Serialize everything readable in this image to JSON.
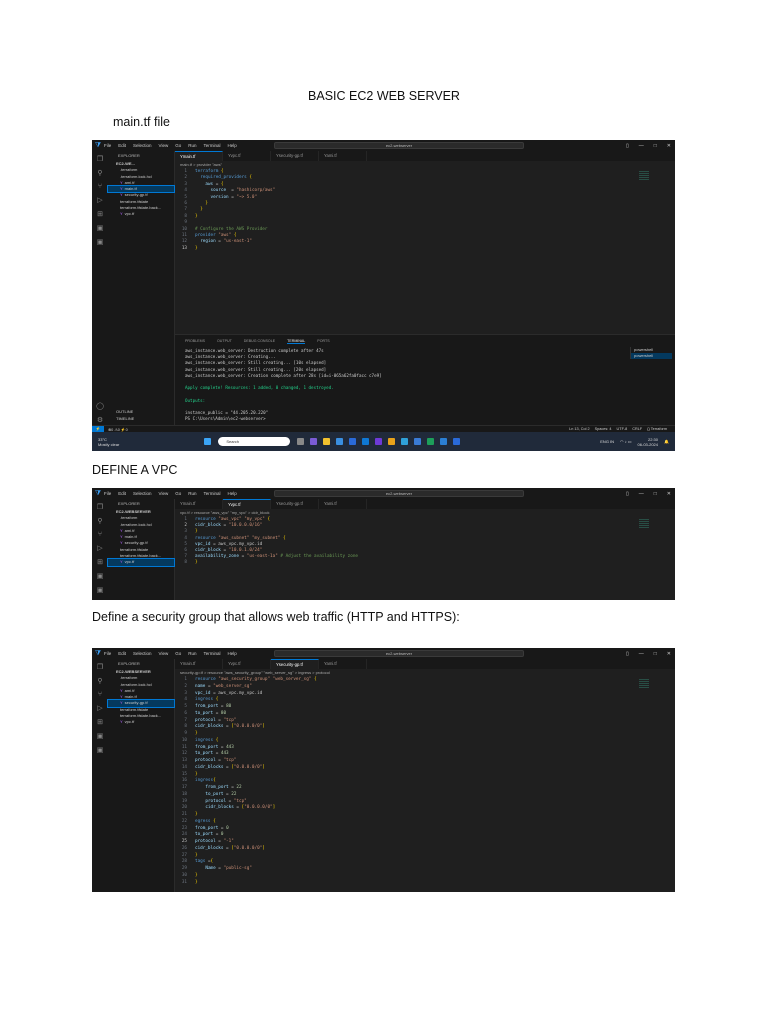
{
  "doc": {
    "title": "BASIC EC2 WEB SERVER",
    "section1": "main.tf file",
    "section2": "DEFINE A VPC",
    "section3": "Define a security group that allows web traffic (HTTP and HTTPS):"
  },
  "vscode": {
    "menu": [
      "File",
      "Edit",
      "Selection",
      "View",
      "Go",
      "Run",
      "Terminal",
      "Help"
    ],
    "search": "ec2-webserver",
    "explorer_label": "EXPLORER",
    "files": [
      ".terraform",
      ".terraform.lock.hcl",
      "ami.tf",
      "main.tf",
      "security-gp.tf",
      "terraform.tfstate",
      "terraform.tfstate.back...",
      "vpc.tf"
    ],
    "tabs": [
      "main.tf",
      "vpc.tf",
      "security-gp.tf",
      "ami.tf"
    ]
  },
  "shot1": {
    "folder": "EC2-WE...",
    "breadcrumb": "main.tf > provider \"aws\"",
    "code": [
      "terraform {",
      "  required_providers {",
      "    aws = {",
      "      source  = \"hashicorp/aws\"",
      "      version = \"~> 5.0\"",
      "    }",
      "  }",
      "}",
      "",
      "# Configure the AWS Provider",
      "provider \"aws\" {",
      "  region = \"us-east-1\"",
      "}"
    ],
    "panel_tabs": [
      "PROBLEMS",
      "OUTPUT",
      "DEBUG CONSOLE",
      "TERMINAL",
      "PORTS"
    ],
    "terminal": [
      "aws_instance.web_server: Destruction complete after 47s",
      "aws_instance.web_server: Creating...",
      "aws_instance.web_server: Still creating... [10s elapsed]",
      "aws_instance.web_server: Still creating... [20s elapsed]",
      "aws_instance.web_server: Creation complete after 28s [id=i-065a62fa0facc c7e9]",
      "",
      "Apply complete! Resources: 1 added, 0 changed, 1 destroyed.",
      "",
      "Outputs:",
      "",
      "instance_public = \"44.205.20.220\"",
      "PS C:\\Users\\Admin\\ec2-webserver> "
    ],
    "terminal_list": [
      "powershell",
      "powershell"
    ],
    "outline": "OUTLINE",
    "timeline": "TIMELINE",
    "status_left": "⊗0 ⚠0   ⚡0",
    "status_right": [
      "Ln 13, Col 2",
      "Spaces: 4",
      "UTF-8",
      "CRLF",
      "{} Terraform"
    ],
    "weather_temp": "33°C",
    "weather_desc": "Mostly clear",
    "taskbar_search": "Search",
    "lang": "ENG IN",
    "time": "22:30",
    "date": "06-03-2024"
  },
  "shot2": {
    "folder": "EC2-WEBSERVER",
    "breadcrumb": "vpc.tf > resource \"aws_vpc\" \"my_vpc\" > cidr_block",
    "code": [
      "resource \"aws_vpc\" \"my_vpc\" {",
      "cidr_block = \"10.0.0.0/16\"",
      "}",
      "resource \"aws_subnet\" \"my_subnet\" {",
      "vpc_id = aws_vpc.my_vpc.id",
      "cidr_block = \"10.0.1.0/24\"",
      "availability_zone = \"us-east-1a\" # Adjust the availability zone",
      "}"
    ]
  },
  "shot3": {
    "folder": "EC2-WEBSERVER",
    "breadcrumb": "security-gp.tf > resource \"aws_security_group\" \"web_server_sg\" > ingress > protocol",
    "code": [
      "resource \"aws_security_group\" \"web_server_sg\" {",
      "name = \"web_server_sg\"",
      "vpc_id = aws_vpc.my_vpc.id",
      "ingress {",
      "from_port = 80",
      "to_port = 80",
      "protocol = \"tcp\"",
      "cidr_blocks = [\"0.0.0.0/0\"]",
      "}",
      "ingress {",
      "from_port = 443",
      "to_port = 443",
      "protocol = \"tcp\"",
      "cidr_blocks = [\"0.0.0.0/0\"]",
      "}",
      "ingress{",
      "    from_port = 22",
      "    to_port = 22",
      "    protocol = \"tcp\"",
      "    cidr_blocks = [\"0.0.0.0/0\"]",
      "}",
      "egress {",
      "from_port = 0",
      "to_port = 0",
      "protocol = \"-1\"",
      "cidr_blocks = [\"0.0.0.0/0\"]",
      "}",
      "tags ={",
      "    Name = \"public-sg\"",
      "}",
      "}"
    ]
  }
}
